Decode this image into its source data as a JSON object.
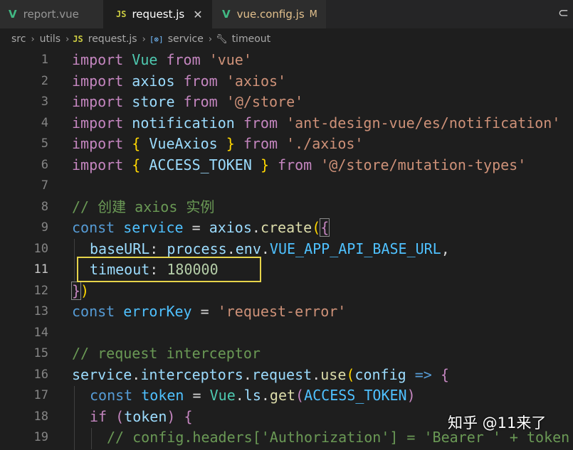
{
  "tabs": [
    {
      "label": "report.vue"
    },
    {
      "label": "request.js",
      "close": "✕"
    },
    {
      "label": "vue.config.js",
      "badge": "M"
    }
  ],
  "breadcrumb": [
    "src",
    "utils",
    "request.js",
    "service",
    "timeout"
  ],
  "line_numbers": [
    "1",
    "2",
    "3",
    "4",
    "5",
    "6",
    "7",
    "8",
    "9",
    "10",
    "11",
    "12",
    "13",
    "14",
    "15",
    "16",
    "17",
    "18",
    "19"
  ],
  "code": {
    "l1": [
      "import",
      " ",
      "Vue",
      " ",
      "from",
      " ",
      "'vue'"
    ],
    "l2": [
      "import",
      " ",
      "axios",
      " ",
      "from",
      " ",
      "'axios'"
    ],
    "l3": [
      "import",
      " ",
      "store",
      " ",
      "from",
      " ",
      "'@/store'"
    ],
    "l4": [
      "import",
      " ",
      "notification",
      " ",
      "from",
      " ",
      "'ant-design-vue/es/notification'"
    ],
    "l5": [
      "import",
      " ",
      "{",
      " ",
      "VueAxios",
      " ",
      "}",
      " ",
      "from",
      " ",
      "'./axios'"
    ],
    "l6": [
      "import",
      " ",
      "{",
      " ",
      "ACCESS_TOKEN",
      " ",
      "}",
      " ",
      "from",
      " ",
      "'@/store/mutation-types'"
    ],
    "l8": "// 创建 axios 实例",
    "l9": [
      "const",
      " ",
      "service",
      " = ",
      "axios",
      ".",
      "create",
      "(",
      "{"
    ],
    "l10": [
      "baseURL",
      ": ",
      "process",
      ".",
      "env",
      ".",
      "VUE_APP_API_BASE_URL",
      ","
    ],
    "l11": [
      "timeout",
      ": ",
      "180000"
    ],
    "l12": [
      "}",
      ")"
    ],
    "l13": [
      "const",
      " ",
      "errorKey",
      " = ",
      "'request-error'"
    ],
    "l15": "// request interceptor",
    "l16": [
      "service",
      ".",
      "interceptors",
      ".",
      "request",
      ".",
      "use",
      "(",
      "config",
      " => ",
      "{"
    ],
    "l17": [
      "const",
      " ",
      "token",
      " = ",
      "Vue",
      ".",
      "ls",
      ".",
      "get",
      "(",
      "ACCESS_TOKEN",
      ")"
    ],
    "l18": [
      "if",
      " (",
      "token",
      ") ",
      "{"
    ],
    "l19": "// config.headers['Authorization'] = 'Bearer ' + token"
  },
  "watermark": "知乎 @11来了",
  "colors": {
    "highlight_box": "#e6d44a",
    "background": "#1e1e1e"
  }
}
